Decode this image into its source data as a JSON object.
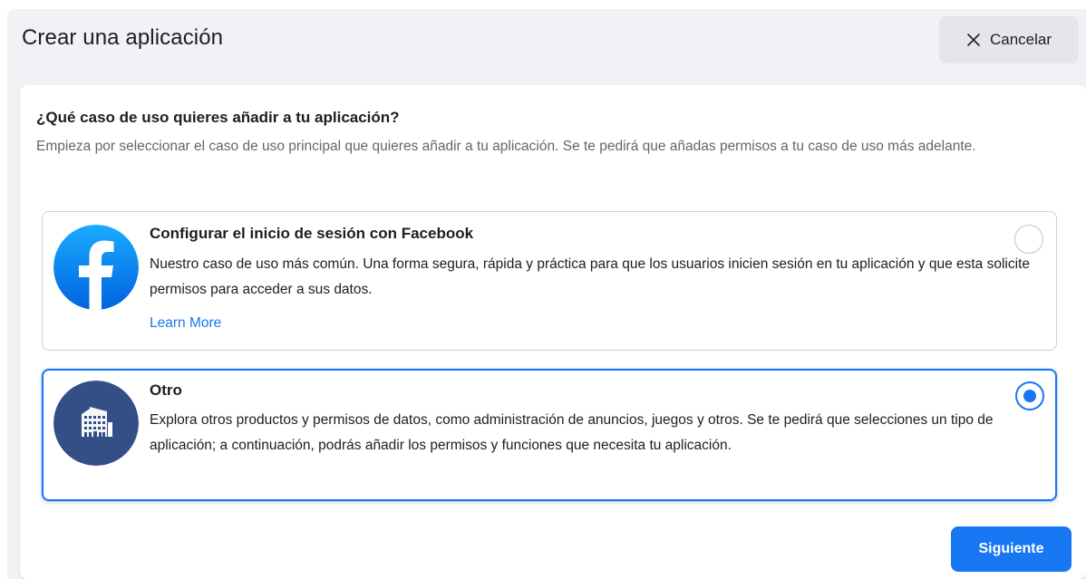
{
  "header": {
    "title": "Crear una aplicación",
    "cancel_label": "Cancelar",
    "cancel_icon": "close-icon"
  },
  "question": {
    "title": "¿Qué caso de uso quieres añadir a tu aplicación?",
    "description": "Empieza por seleccionar el caso de uso principal que quieres añadir a tu aplicación. Se te pedirá que añadas permisos a tu caso de uso más adelante."
  },
  "options": [
    {
      "icon": "facebook-logo-icon",
      "title": "Configurar el inicio de sesión con Facebook",
      "description": "Nuestro caso de uso más común. Una forma segura, rápida y práctica para que los usuarios inicien sesión en tu aplicación y que esta solicite permisos para acceder a sus datos.",
      "link": "Learn More",
      "selected": false
    },
    {
      "icon": "building-icon",
      "title": "Otro",
      "description": "Explora otros productos y permisos de datos, como administración de anuncios, juegos y otros. Se te pedirá que selecciones un tipo de aplicación; a continuación, podrás añadir los permisos y funciones que necesita tu aplicación.",
      "selected": true
    }
  ],
  "footer": {
    "next_label": "Siguiente"
  },
  "colors": {
    "accent": "#1877f2",
    "page_bg": "#f0f2f5",
    "building_icon_bg": "#344e86"
  }
}
